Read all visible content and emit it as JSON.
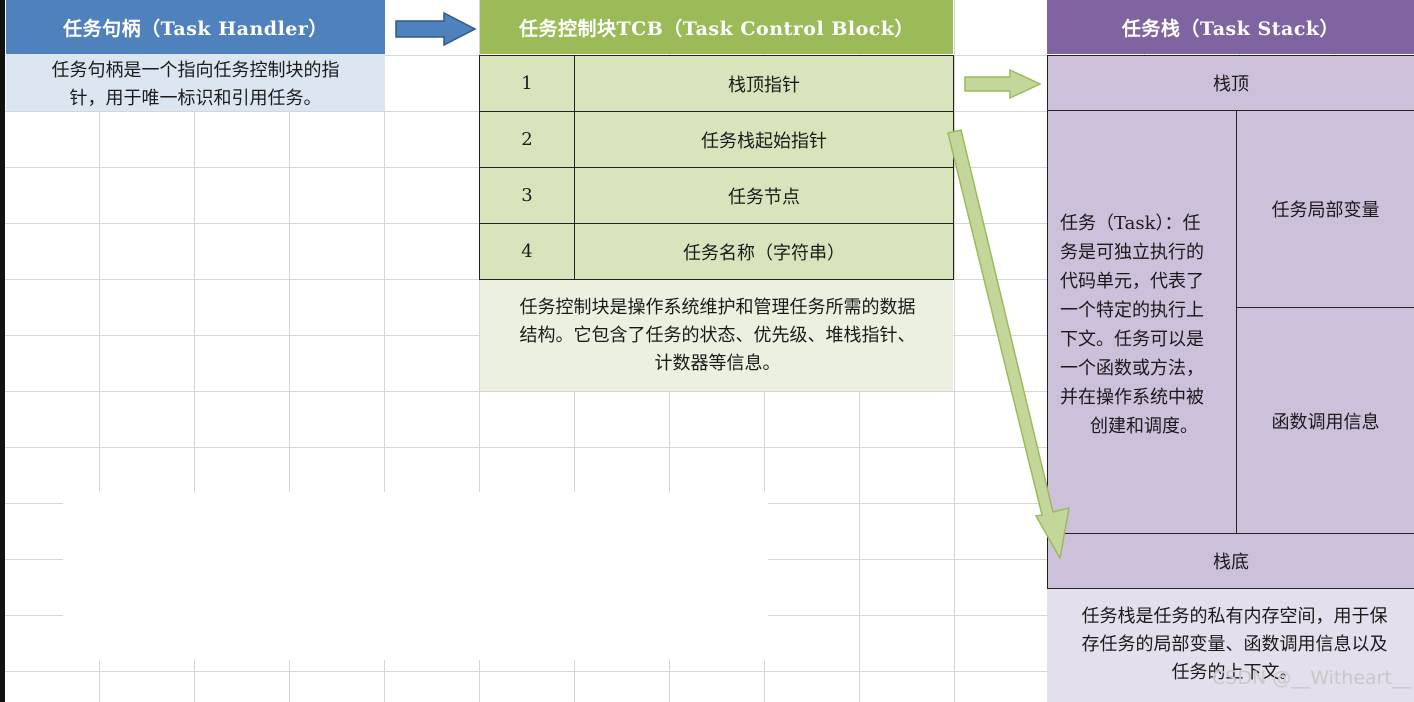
{
  "task_handler": {
    "header": "任务句柄（Task Handler）",
    "description_lines": [
      "任务句柄是一个指向任务控制块的指",
      "针，用于唯一标识和引用任务。"
    ]
  },
  "tcb": {
    "header": "任务控制块TCB（Task Control Block）",
    "rows": [
      {
        "num": "1",
        "label": "栈顶指针"
      },
      {
        "num": "2",
        "label": "任务栈起始指针"
      },
      {
        "num": "3",
        "label": "任务节点"
      },
      {
        "num": "4",
        "label": "任务名称（字符串）"
      }
    ],
    "description_lines": [
      "任务控制块是操作系统维护和管理任务所需的数据",
      "结构。它包含了任务的状态、优先级、堆栈指针、",
      "计数器等信息。"
    ]
  },
  "task_stack": {
    "header": "任务栈（Task Stack）",
    "top_label": "栈顶",
    "bottom_label": "栈底",
    "task_description_lines": [
      "任务（Task）：任",
      "务是可独立执行的",
      "代码单元，代表了",
      "一个特定的执行上",
      "下文。任务可以是",
      "一个函数或方法，",
      "并在操作系统中被",
      "创建和调度。"
    ],
    "local_vars_label": "任务局部变量",
    "call_info_label": "函数调用信息",
    "description_lines": [
      "任务栈是任务的私有内存空间，用于保",
      "存任务的局部变量、函数调用信息以及",
      "任务的上下文。"
    ]
  },
  "watermark": "CSDN @__Witheart__",
  "colors": {
    "handler_header": "#4f81bd",
    "handler_fill": "#dce6f1",
    "tcb_header": "#9bbb59",
    "tcb_row_fill": "#d8e4bc",
    "tcb_desc_fill": "#ebf1de",
    "stack_header": "#8064a2",
    "stack_fill": "#ccc0da",
    "stack_desc_fill": "#e4dfec",
    "arrow_blue": "#4f81bd",
    "arrow_green": "#c4d79b"
  }
}
